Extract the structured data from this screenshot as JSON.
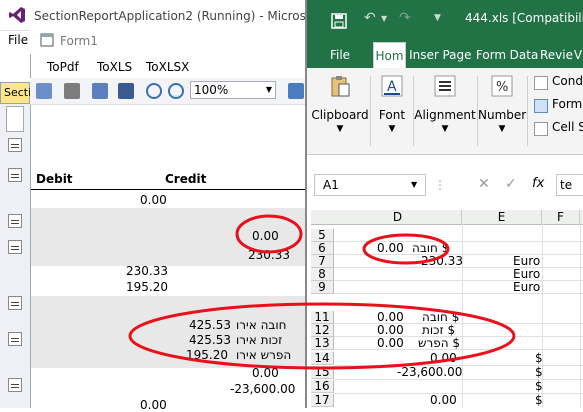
{
  "vs": {
    "title": "SectionReportApplication2 (Running) - Microsoft V",
    "menu_file": "File",
    "side_tab": "Secti"
  },
  "form": {
    "title": "Form1",
    "menu": [
      "ToPdf",
      "ToXLS",
      "ToXLSX"
    ],
    "zoom": "100%",
    "headers": {
      "debit": "Debit",
      "credit": "Credit"
    },
    "rows": [
      {
        "text": "0.00"
      },
      {
        "text": "0.00"
      },
      {
        "text": "230.33"
      },
      {
        "text": "230.33"
      },
      {
        "text": "195.20"
      },
      {
        "text": "425.53",
        "label": "חובה  אירו"
      },
      {
        "text": "425.53",
        "label": "זכות  אירו"
      },
      {
        "text": "195.20",
        "label": "הפרש  אירו"
      },
      {
        "text": "0.00"
      },
      {
        "text": "-23,600.00"
      },
      {
        "text": "0.00"
      },
      {
        "text": "0.00"
      }
    ]
  },
  "excel": {
    "filename": "444.xls  [Compatibility",
    "tabs": [
      "File",
      "Hom",
      "Inser",
      "Page",
      "Form",
      "Data",
      "Revie",
      "V"
    ],
    "active_tab": "Hom",
    "groups": [
      {
        "label": "Clipboard"
      },
      {
        "label": "Font"
      },
      {
        "label": "Alignment"
      },
      {
        "label": "Number"
      }
    ],
    "side_items": [
      "Cond",
      "Forma",
      "Cell S"
    ],
    "name_box": "A1",
    "formula_partial": "te",
    "fx": "fx",
    "columns": [
      "D",
      "E",
      "F"
    ],
    "rows": [
      {
        "n": "5",
        "d": "",
        "e": "",
        "f": ""
      },
      {
        "n": "6",
        "d_num": "0.00",
        "d_label": "חובה $",
        "e": "",
        "f": ""
      },
      {
        "n": "7",
        "d_num": "230.33",
        "e": "Euro",
        "f": ""
      },
      {
        "n": "8",
        "d_num": "",
        "e": "Euro",
        "f": ""
      },
      {
        "n": "9",
        "d_num": "",
        "e": "Euro",
        "f": ""
      },
      {
        "n": "11",
        "d_num": "0.00",
        "d_label": "חובה $",
        "e": "",
        "f": ""
      },
      {
        "n": "12",
        "d_num": "0.00",
        "d_label": "זכות $",
        "e": "",
        "f": ""
      },
      {
        "n": "13",
        "d_num": "0.00",
        "d_label": "הפרש $",
        "e": "",
        "f": ""
      },
      {
        "n": "14",
        "d_num": "0.00",
        "e": "$",
        "f": ""
      },
      {
        "n": "15",
        "d_num": "-23,600.00",
        "e": "$",
        "f": ""
      },
      {
        "n": "16",
        "d_num": "",
        "e": "$",
        "f": ""
      },
      {
        "n": "17",
        "d_num": "0.00",
        "e": "$",
        "f": ""
      }
    ]
  },
  "annotation_color": "#e8101a"
}
